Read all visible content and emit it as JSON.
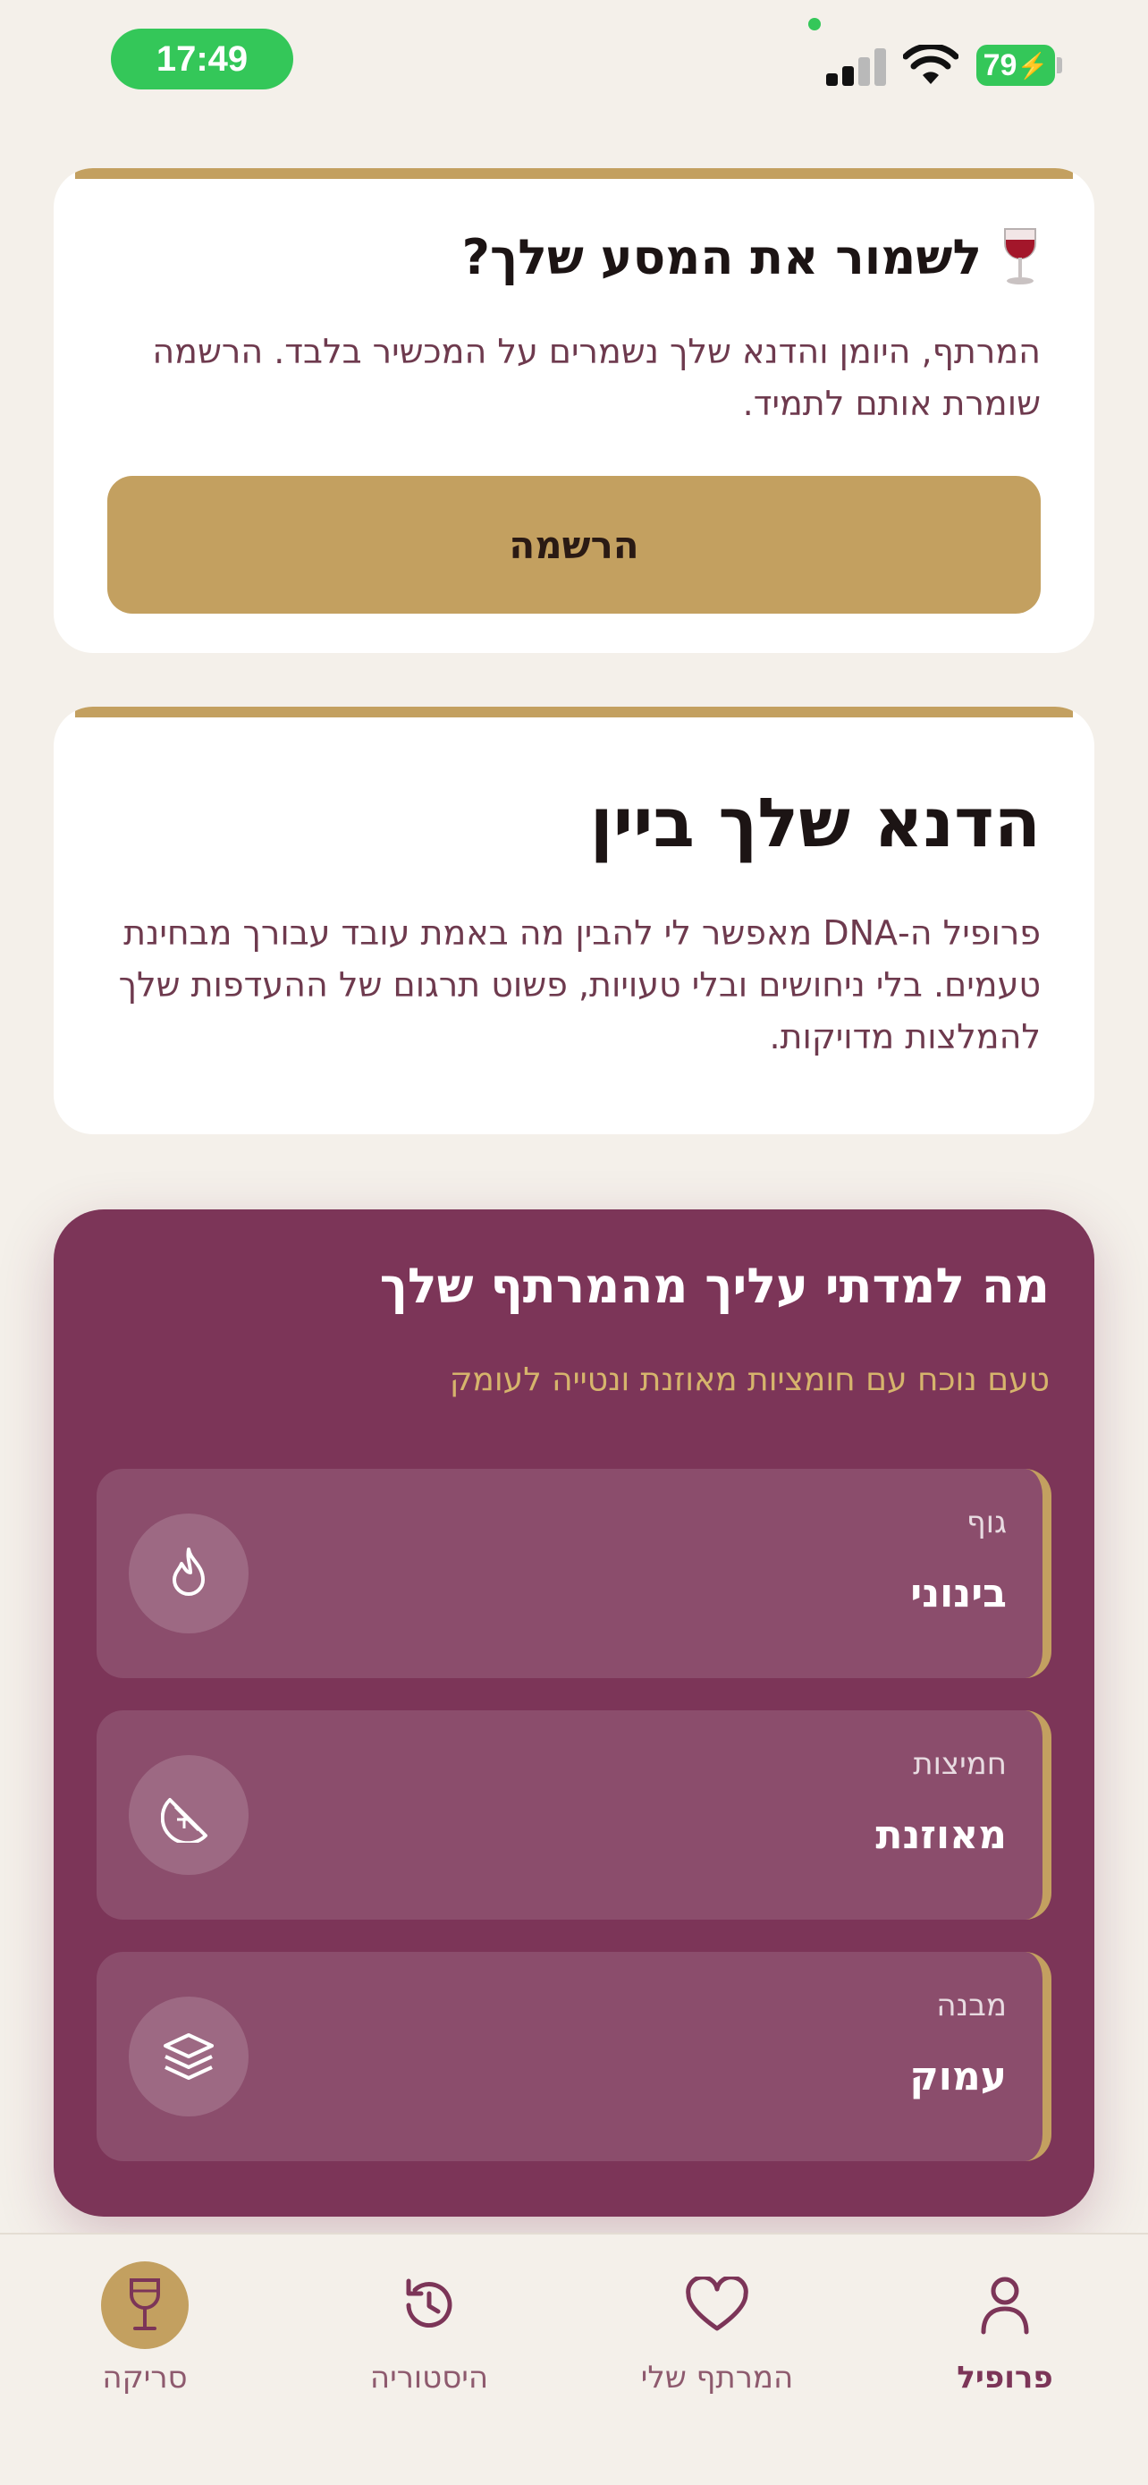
{
  "status_bar": {
    "time": "17:49",
    "battery": "79"
  },
  "save_card": {
    "title": "לשמור את המסע שלך?",
    "icon": "wine-glass-icon",
    "description": "המרתף, היומן והדנא שלך נשמרים על המכשיר בלבד. הרשמה שומרת אותם לתמיד.",
    "button_label": "הרשמה"
  },
  "dna_card": {
    "title": "הדנא שלך ביין",
    "description": "פרופיל ה-DNA מאפשר לי להבין מה באמת עובד עבורך מבחינת טעמים. בלי ניחושים ובלי טעויות, פשוט תרגום של ההעדפות שלך להמלצות מדויקות."
  },
  "cellar_card": {
    "title": "מה למדתי עליך מהמרתף שלך",
    "subtitle": "טעם נוכח עם חומציות מאוזנת ונטייה לעומק",
    "traits": [
      {
        "label": "גוף",
        "value": "בינוני",
        "icon": "flame-icon"
      },
      {
        "label": "חמיצות",
        "value": "מאוזנת",
        "icon": "citrus-icon"
      },
      {
        "label": "מבנה",
        "value": "עמוק",
        "icon": "layers-icon"
      }
    ]
  },
  "bottom_nav": {
    "items": [
      {
        "label": "סריקה",
        "icon": "wine-glass-icon",
        "active": true
      },
      {
        "label": "היסטוריה",
        "icon": "history-icon",
        "active": false
      },
      {
        "label": "המרתף שלי",
        "icon": "heart-icon",
        "active": false
      },
      {
        "label": "פרופיל",
        "icon": "profile-icon",
        "active": false
      }
    ]
  },
  "colors": {
    "background": "#f4f0ea",
    "gold": "#c3a060",
    "plum": "#7c3558",
    "status_green": "#34c759"
  }
}
